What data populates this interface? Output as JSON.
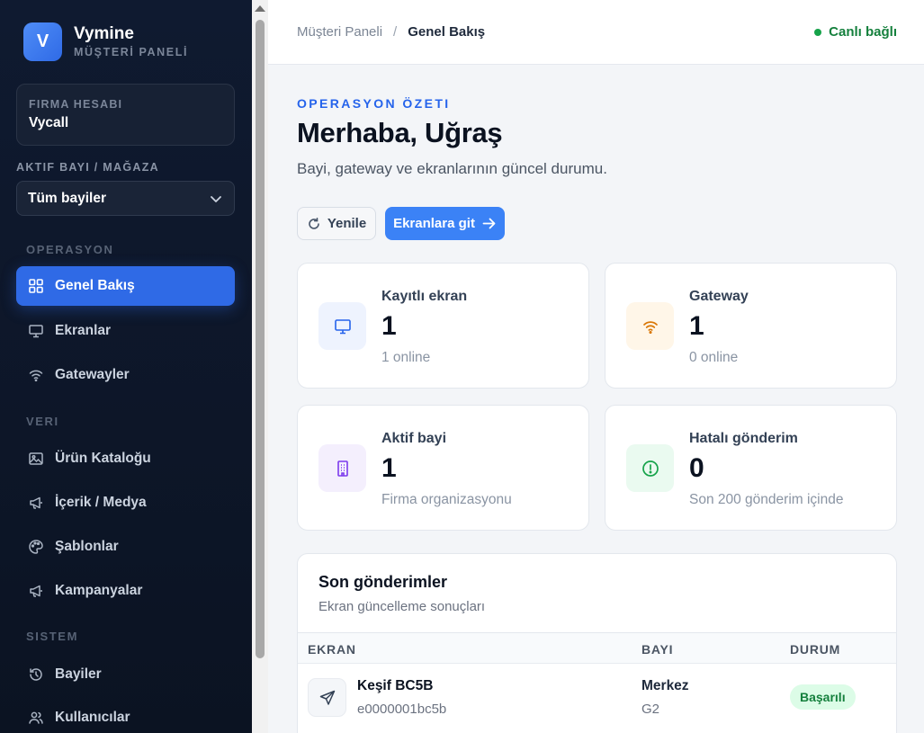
{
  "sidebar": {
    "brand_initial": "V",
    "brand_name": "Vymine",
    "brand_sub": "MÜŞTERİ PANELİ",
    "firm_label": "FIRMA HESABI",
    "firm_value": "Vycall",
    "dealer_label": "AKTIF BAYI / MAĞAZA",
    "dealer_value": "Tüm bayiler",
    "sections": {
      "ops": "OPERASYON",
      "data": "VERI",
      "system": "SISTEM"
    },
    "items": [
      {
        "label": "Genel Bakış",
        "icon": "grid-icon",
        "active": true
      },
      {
        "label": "Ekranlar",
        "icon": "monitor-icon"
      },
      {
        "label": "Gatewayler",
        "icon": "wifi-icon"
      },
      {
        "label": "Ürün Kataloğu",
        "icon": "image-icon"
      },
      {
        "label": "İçerik / Medya",
        "icon": "megaphone-icon"
      },
      {
        "label": "Şablonlar",
        "icon": "palette-icon"
      },
      {
        "label": "Kampanyalar",
        "icon": "megaphone-icon"
      },
      {
        "label": "Bayiler",
        "icon": "history-icon"
      },
      {
        "label": "Kullanıcılar",
        "icon": "users-icon"
      }
    ]
  },
  "topbar": {
    "crumb_root": "Müşteri Paneli",
    "crumb_sep": "/",
    "crumb_current": "Genel Bakış",
    "live_label": "Canlı bağlı"
  },
  "header": {
    "kicker": "OPERASYON ÖZETI",
    "title": "Merhaba, Uğraş",
    "lede": "Bayi, gateway ve ekranlarının güncel durumu.",
    "refresh_label": "Yenile",
    "go_label": "Ekranlara git"
  },
  "stats": [
    {
      "label": "Kayıtlı ekran",
      "value": "1",
      "sub": "1 online",
      "icon": "monitor-icon"
    },
    {
      "label": "Gateway",
      "value": "1",
      "sub": "0 online",
      "icon": "wifi-icon"
    },
    {
      "label": "Aktif bayi",
      "value": "1",
      "sub": "Firma organizasyonu",
      "icon": "building-icon"
    },
    {
      "label": "Hatalı gönderim",
      "value": "0",
      "sub": "Son 200 gönderim içinde",
      "icon": "alert-circle-icon"
    }
  ],
  "recent": {
    "title": "Son gönderimler",
    "subtitle": "Ekran güncelleme sonuçları",
    "columns": [
      "EKRAN",
      "BAYI",
      "DURUM"
    ],
    "rows": [
      {
        "screen": "Keşif BC5B",
        "mac": "e0000001bc5b",
        "dealer": "Merkez",
        "group": "G2",
        "status": "Başarılı"
      }
    ]
  },
  "colors": {
    "accent": "#2f6ae6",
    "sidebar_bg": "#0f1a30",
    "success": "#15803d"
  }
}
